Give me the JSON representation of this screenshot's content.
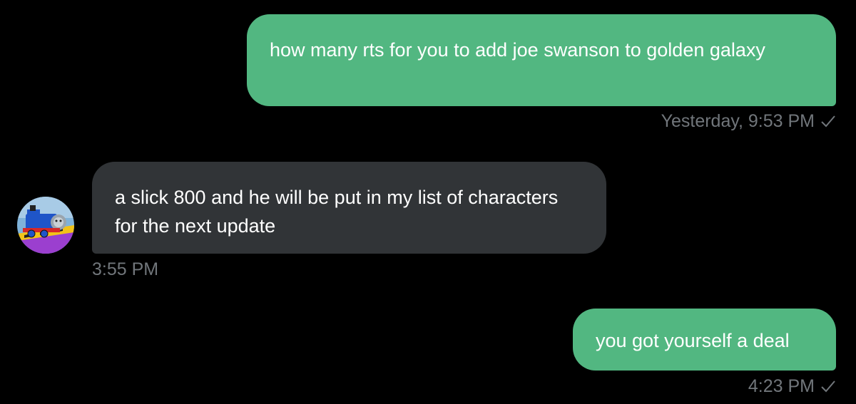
{
  "conversation": {
    "messages": [
      {
        "direction": "sent",
        "text": "how many rts for you to add joe swanson to golden galaxy",
        "timestamp": "Yesterday, 9:53 PM",
        "status_icon": "check-icon"
      },
      {
        "direction": "received",
        "text": "a slick 800 and he will be put in my list of characters for the next update",
        "timestamp": "3:55 PM",
        "avatar_icon": "toy-train-avatar"
      },
      {
        "direction": "sent",
        "text": "you got yourself a deal",
        "timestamp": "4:23 PM",
        "status_icon": "check-icon"
      }
    ]
  },
  "colors": {
    "background": "#000000",
    "sent_bubble": "#52b781",
    "received_bubble": "#313437",
    "message_text": "#ffffff",
    "meta_text": "#71767b"
  }
}
